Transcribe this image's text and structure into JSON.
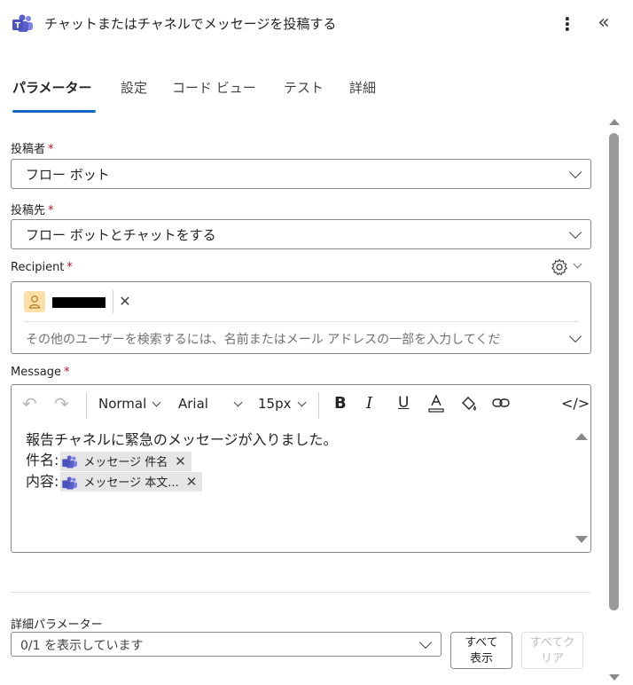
{
  "header": {
    "title": "チャットまたはチャネルでメッセージを投稿する"
  },
  "tabs": [
    {
      "label": "パラメーター",
      "active": true
    },
    {
      "label": "設定"
    },
    {
      "label": "コード ビュー"
    },
    {
      "label": "テスト"
    },
    {
      "label": "詳細"
    }
  ],
  "post_as": {
    "label": "投稿者",
    "required": "*",
    "value": "フロー ボット"
  },
  "post_in": {
    "label": "投稿先",
    "required": "*",
    "value": "フロー ボットとチャットをする"
  },
  "recipient": {
    "label": "Recipient",
    "required": "*",
    "placeholder": "その他のユーザーを検索するには、名前またはメール アドレスの一部を入力してくだ"
  },
  "message": {
    "label": "Message",
    "required": "*",
    "toolbar": {
      "format": "Normal",
      "font": "Arial",
      "size": "15px"
    },
    "line1": "報告チャネルに緊急のメッセージが入りました。",
    "line2_label": "件名:",
    "token1": "メッセージ 件名",
    "line3_label": "内容:",
    "token2": "メッセージ 本文..."
  },
  "advanced": {
    "label": "詳細パラメーター",
    "value": "0/1 を表示しています",
    "show_all": "すべて\n表示",
    "clear_all": "すべてク\nリア"
  },
  "colors": {
    "accent": "#0f6cbd",
    "required": "#c50f1f",
    "teams": "#5b5fc7"
  }
}
